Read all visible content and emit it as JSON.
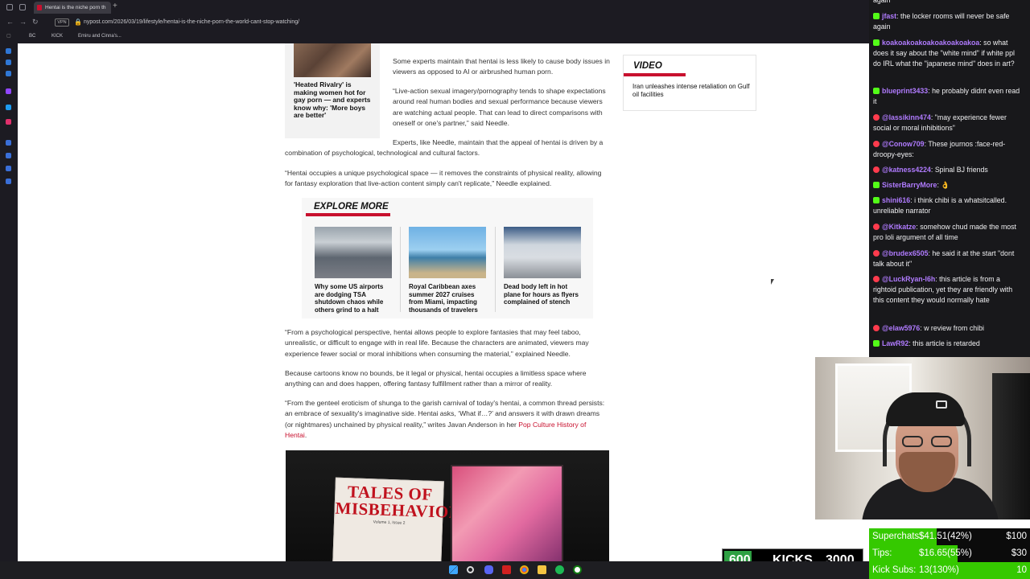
{
  "browser": {
    "tab_title": "Hentai is the niche porn th",
    "url": "nypost.com/2026/03/19/lifestyle/hentai-is-the-niche-porn-the-world-cant-stop-watching/",
    "vpn_label": "VPN",
    "bookmarks": [
      "BC",
      "KICK",
      "Emiru and Cinna's..."
    ]
  },
  "article": {
    "related_caption": "'Heated Rivalry' is making women hot for gay porn — and experts know why: 'More boys are better'",
    "p1": "Some experts maintain that hentai is less likely to cause body issues in viewers as opposed to AI or airbrushed human porn.",
    "p2": "“Live-action sexual imagery/pornography tends to shape expectations around real human bodies and sexual performance because viewers are watching actual people. That can lead to direct comparisons with oneself or one's partner,” said Needle.",
    "p3": "Experts, like Needle, maintain that the appeal of hentai is driven by a combination of psychological, technological and cultural factors.",
    "p4": "“Hentai occupies a unique psychological space — it removes the constraints of physical reality, allowing for fantasy exploration that live-action content simply can't replicate,” Needle explained.",
    "p5": "“From a psychological perspective, hentai allows people to explore fantasies that may feel taboo, unrealistic, or difficult to engage with in real life. Because the characters are animated, viewers may experience fewer social or moral inhibitions when consuming the material,” explained Needle.",
    "p6": "Because cartoons know no bounds, be it legal or physical, hentai occupies a limitless space where anything can and does happen, offering fantasy fulfillment rather than a mirror of reality.",
    "p7_text": "“From the genteel eroticism of shunga to the garish carnival of today's hentai, a common thread persists: an embrace of sexuality's imaginative side. Hentai asks, ‘What if…?’ and answers it with drawn dreams (or nightmares) unchained by physical reality,” writes Javan Anderson in her ",
    "p7_link": "Pop Culture History of Hentai",
    "p7_end": ".",
    "video_title": "VIDEO",
    "video_item": "Iran unleashes intense retaliation on Gulf oil facilities",
    "explore_title": "EXPLORE MORE",
    "explore_items": [
      {
        "caption": "Why some US airports are dodging TSA shutdown chaos while others grind to a halt"
      },
      {
        "caption": "Royal Caribbean axes summer 2027 cruises from Miami, impacting thousands of travelers"
      },
      {
        "caption": "Dead body left in hot plane for hours as flyers complained of stench"
      }
    ],
    "hero_book_title": "TALES OF MISBEHAVIOR",
    "hero_book_sub": "Volume 1, Issue 2"
  },
  "chat": {
    "messages": [
      {
        "badge": "none",
        "user": "",
        "text": "again",
        "color": "#efeff1"
      },
      {
        "badge": "kick",
        "user": "jfast",
        "text": "the locker rooms will never be safe again",
        "color": "#b07bff"
      },
      {
        "badge": "kick",
        "user": "koakoakoakoakoakoakoakoa",
        "text": "so what does it say about the \"white mind\" if white ppl do IRL what the \"japanese mind\" does in art?",
        "color": "#b07bff"
      },
      {
        "badge": "kick",
        "user": "blueprint3433",
        "text": "he probably didnt even read it",
        "color": "#b07bff"
      },
      {
        "badge": "yt",
        "user": "@lassikinn474",
        "text": "\"may experience fewer social or moral inhibitions\"",
        "color": "#b07bff"
      },
      {
        "badge": "yt",
        "user": "@Conow709",
        "text": "These journos :face-red-droopy-eyes:",
        "color": "#b07bff"
      },
      {
        "badge": "yt",
        "user": "@katness4224",
        "text": "Spinal BJ friends",
        "color": "#b07bff"
      },
      {
        "badge": "kick",
        "user": "SisterBarryMore",
        "text": "👌",
        "color": "#b07bff"
      },
      {
        "badge": "kick",
        "user": "shini616",
        "text": "i think chibi is a whatsitcalled. unreliable narrator",
        "color": "#b07bff"
      },
      {
        "badge": "yt",
        "user": "@Kitkatze",
        "text": "somehow chud made the most pro loli argument of all time",
        "color": "#b07bff"
      },
      {
        "badge": "yt",
        "user": "@brudex6505",
        "text": "he said it at the start \"dont talk about it\"",
        "color": "#b07bff"
      },
      {
        "badge": "yt",
        "user": "@LuckRyan-l6h",
        "text": "this article is from a rightoid publication, yet they are friendly with this content they would normally hate",
        "color": "#b07bff"
      },
      {
        "badge": "yt",
        "user": "@elaw5976",
        "text": "w review from chibi",
        "color": "#b07bff"
      },
      {
        "badge": "kick",
        "user": "LawR92",
        "text": "this article is retarded",
        "color": "#b07bff"
      }
    ]
  },
  "kick_goal": {
    "current": "600",
    "label": "KICKS",
    "goal": "3000",
    "progress": 0.2
  },
  "goals": [
    {
      "label": "Superchats:",
      "value": "$41.51(42%)",
      "target": "$100",
      "progress": 0.42
    },
    {
      "label": "Tips:",
      "value": "$16.65(55%)",
      "target": "$30",
      "progress": 0.55
    },
    {
      "label": "Kick Subs:",
      "value": "13(130%)",
      "target": "10",
      "progress": 1.0
    }
  ],
  "colors": {
    "accent": "#c8102e",
    "chat_bg": "#18181b",
    "goal_green": "#35c900",
    "kick_green": "#53fc18"
  }
}
